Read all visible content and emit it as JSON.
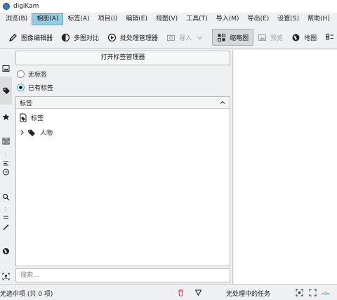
{
  "window": {
    "title": "digiKam"
  },
  "menu": [
    "浏览(B)",
    "相册(A)",
    "标签(A)",
    "项目(I)",
    "编辑(E)",
    "视图(V)",
    "工具(T)",
    "导入(M)",
    "导出(E)",
    "设置(S)",
    "帮助(H)"
  ],
  "menu_active_index": 1,
  "toolbar": {
    "image_editor": "图像编辑器",
    "compare": "多图对比",
    "batch_queue": "批处理管理器",
    "import": "导入",
    "thumbnails": "缩略图",
    "preview": "预览",
    "map": "地图"
  },
  "panel": {
    "open_tag_manager": "打开标签管理器",
    "no_tags": "无标签",
    "has_tags": "已有标签",
    "tree_header": "标签",
    "root_tag": "标签",
    "child_tag": "人物",
    "search_placeholder": "搜索..."
  },
  "status": {
    "selection": "无选中项 (共 0 项)",
    "tasks": "无处理中的任务"
  },
  "colors": {
    "accent": "#3daee9",
    "menu_active_bg": "#93cee9"
  }
}
